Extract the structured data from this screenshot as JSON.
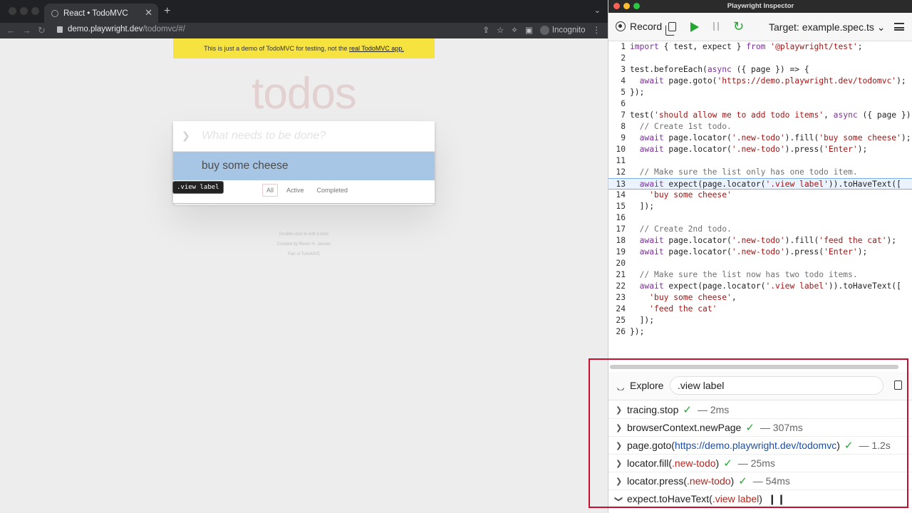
{
  "browser": {
    "tab_title": "React • TodoMVC",
    "url_host": "demo.playwright.dev",
    "url_path": "/todomvc/#/",
    "incognito_label": "Incognito"
  },
  "page": {
    "banner_text": "This is just a demo of TodoMVC for testing, not the ",
    "banner_link": "real TodoMVC app.",
    "title": "todos",
    "new_todo_placeholder": "What needs to be done?",
    "todos": [
      "buy some cheese"
    ],
    "filters": [
      "All",
      "Active",
      "Completed"
    ],
    "selected_filter": "All",
    "tooltip": ".view label",
    "info_lines": [
      "Double-click to edit a todo",
      "Created by Remo H. Jansen",
      "Part of TodoMVC"
    ]
  },
  "inspector": {
    "window_title": "Playwright Inspector",
    "record_label": "Record",
    "target_label": "Target: example.spec.ts",
    "explore_label": "Explore",
    "selector_value": ".view label",
    "active_line": 13,
    "code": [
      "import { test, expect } from '@playwright/test';",
      "",
      "test.beforeEach(async ({ page }) => {",
      "  await page.goto('https://demo.playwright.dev/todomvc');",
      "});",
      "",
      "test('should allow me to add todo items', async ({ page }) =>",
      "  // Create 1st todo.",
      "  await page.locator('.new-todo').fill('buy some cheese');",
      "  await page.locator('.new-todo').press('Enter');",
      "",
      "  // Make sure the list only has one todo item.",
      "  await expect(page.locator('.view label')).toHaveText([",
      "    'buy some cheese'",
      "  ]);",
      "",
      "  // Create 2nd todo.",
      "  await page.locator('.new-todo').fill('feed the cat');",
      "  await page.locator('.new-todo').press('Enter');",
      "",
      "  // Make sure the list now has two todo items.",
      "  await expect(page.locator('.view label')).toHaveText([",
      "    'buy some cheese',",
      "    'feed the cat'",
      "  ]);",
      "});"
    ],
    "call_log": [
      {
        "method": "tracing.stop",
        "arg": "",
        "arg_type": "",
        "status": "done",
        "duration": "— 2ms"
      },
      {
        "method": "browserContext.newPage",
        "arg": "",
        "arg_type": "",
        "status": "done",
        "duration": "— 307ms"
      },
      {
        "method": "page.goto",
        "arg": "https://demo.playwright.dev/todomvc",
        "arg_type": "url",
        "status": "done",
        "duration": "— 1.2s"
      },
      {
        "method": "locator.fill",
        "arg": ".new-todo",
        "arg_type": "selector",
        "status": "done",
        "duration": "— 25ms"
      },
      {
        "method": "locator.press",
        "arg": ".new-todo",
        "arg_type": "selector",
        "status": "done",
        "duration": "— 54ms"
      },
      {
        "method": "expect.toHaveText",
        "arg": ".view label",
        "arg_type": "selector",
        "status": "paused",
        "duration": ""
      }
    ]
  },
  "colors": {
    "accent_green": "#22a82f",
    "highlight_red": "#c8102e",
    "todo_highlight": "#a7c5e4",
    "banner_yellow": "#f6e33f"
  }
}
